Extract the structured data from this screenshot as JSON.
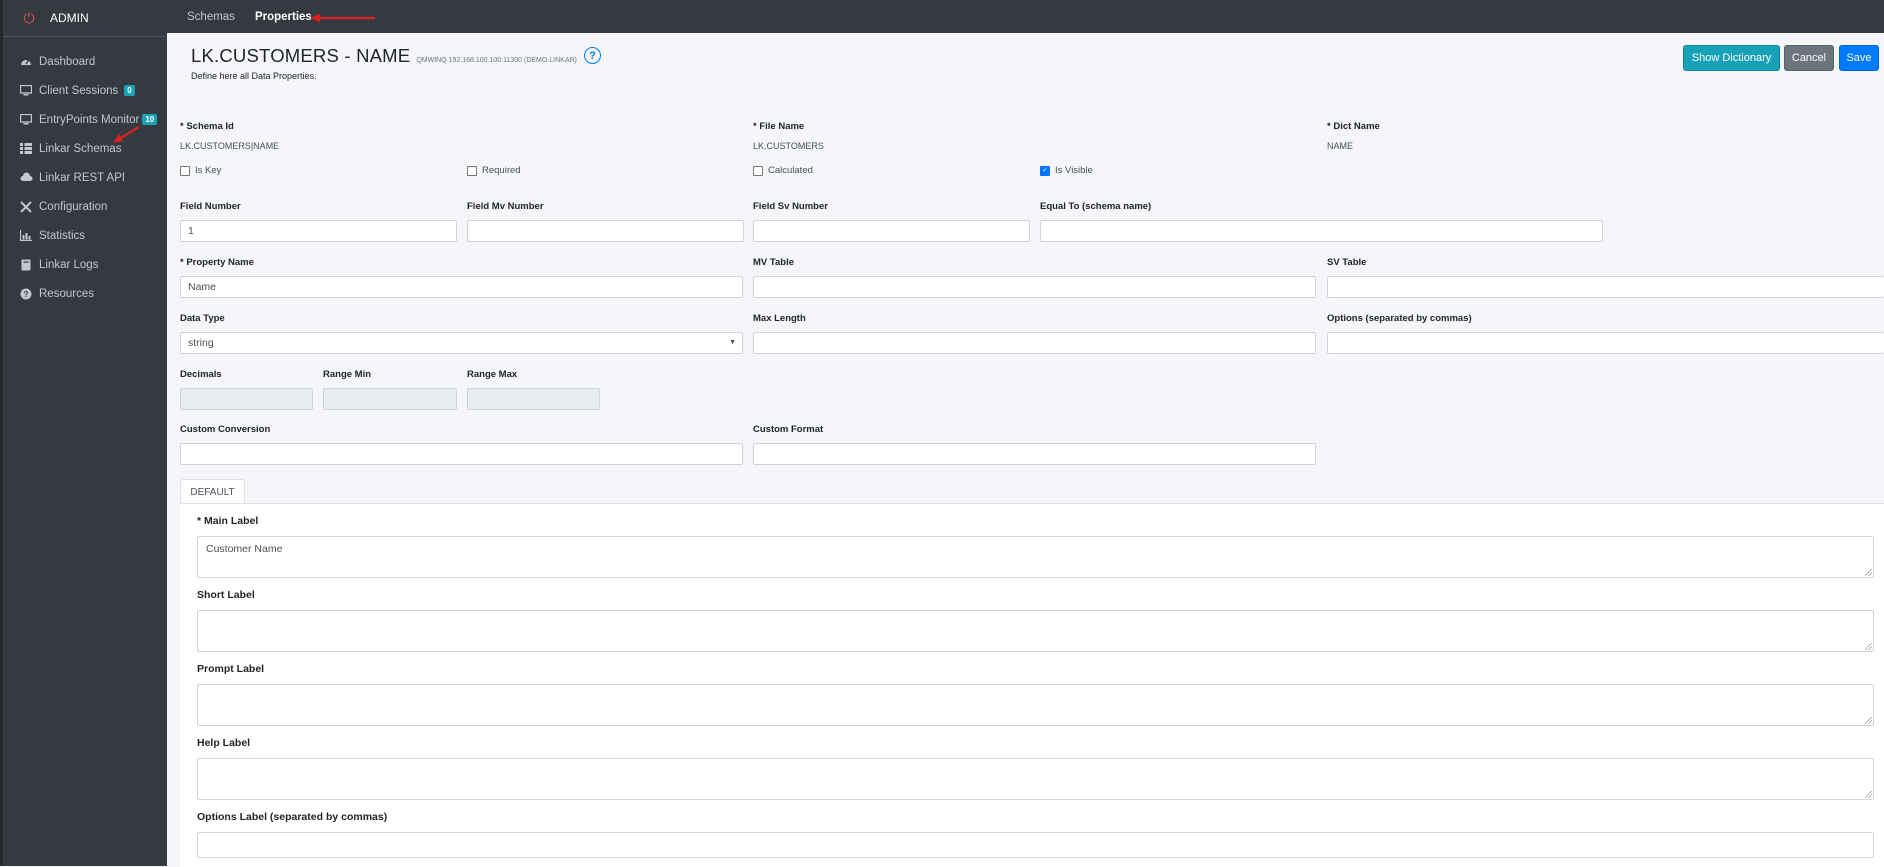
{
  "sidebar": {
    "brand": "ADMIN",
    "items": [
      {
        "label": "Dashboard",
        "icon": "dashboard-icon"
      },
      {
        "label": "Client Sessions",
        "icon": "monitor-icon",
        "badge": "0"
      },
      {
        "label": "EntryPoints Monitor",
        "icon": "monitor-icon",
        "badge": "10"
      },
      {
        "label": "Linkar Schemas",
        "icon": "grid-icon"
      },
      {
        "label": "Linkar REST API",
        "icon": "cloud-icon"
      },
      {
        "label": "Configuration",
        "icon": "tools-icon"
      },
      {
        "label": "Statistics",
        "icon": "chart-icon"
      },
      {
        "label": "Linkar Logs",
        "icon": "book-icon"
      },
      {
        "label": "Resources",
        "icon": "question-circle-icon"
      }
    ]
  },
  "topbar": {
    "tabs": [
      {
        "label": "Schemas"
      },
      {
        "label": "Properties",
        "active": true
      }
    ]
  },
  "header": {
    "title": "LK.CUSTOMERS - NAME",
    "server": "QMWINQ 192.168.100.100:11300 (DEMO.LINKAR)",
    "subtitle": "Define here all Data Properties.",
    "help_icon": "question-circle-icon",
    "buttons": {
      "dictionary": "Show Dictionary",
      "cancel": "Cancel",
      "save": "Save"
    }
  },
  "form": {
    "schema_id": {
      "label": "* Schema Id",
      "value": "LK.CUSTOMERS|NAME"
    },
    "file_name": {
      "label": "* File Name",
      "value": "LK.CUSTOMERS"
    },
    "dict_name": {
      "label": "* Dict Name",
      "value": "NAME"
    },
    "checks": {
      "is_key": {
        "label": "Is Key",
        "checked": false
      },
      "required": {
        "label": "Required",
        "checked": false
      },
      "calculated": {
        "label": "Calculated",
        "checked": false
      },
      "is_visible": {
        "label": "Is Visible",
        "checked": true
      }
    },
    "field_number": {
      "label": "Field Number",
      "value": "1"
    },
    "field_mv_number": {
      "label": "Field Mv Number",
      "value": ""
    },
    "field_sv_number": {
      "label": "Field Sv Number",
      "value": ""
    },
    "equal_to": {
      "label": "Equal To (schema name)",
      "value": ""
    },
    "property_name": {
      "label": "* Property Name",
      "value": "Name"
    },
    "mv_table": {
      "label": "MV Table",
      "value": ""
    },
    "sv_table": {
      "label": "SV Table",
      "value": ""
    },
    "data_type": {
      "label": "Data Type",
      "value": "string"
    },
    "max_length": {
      "label": "Max Length",
      "value": ""
    },
    "options": {
      "label": "Options (separated by commas)",
      "value": ""
    },
    "decimals": {
      "label": "Decimals",
      "value": ""
    },
    "range_min": {
      "label": "Range Min",
      "value": ""
    },
    "range_max": {
      "label": "Range Max",
      "value": ""
    },
    "custom_conversion": {
      "label": "Custom Conversion",
      "value": ""
    },
    "custom_format": {
      "label": "Custom Format",
      "value": ""
    }
  },
  "labels_tab": {
    "tab": "DEFAULT",
    "main_label": {
      "label": "* Main Label",
      "value": "Customer Name"
    },
    "short_label": {
      "label": "Short Label",
      "value": ""
    },
    "prompt_label": {
      "label": "Prompt Label",
      "value": ""
    },
    "help_label": {
      "label": "Help Label",
      "value": ""
    },
    "options_label": {
      "label": "Options Label (separated by commas)",
      "value": ""
    }
  },
  "colors": {
    "sidebar_bg": "#343a40",
    "info": "#17a2b8",
    "secondary": "#6c757d",
    "primary": "#007bff",
    "annotation": "#e02020"
  }
}
